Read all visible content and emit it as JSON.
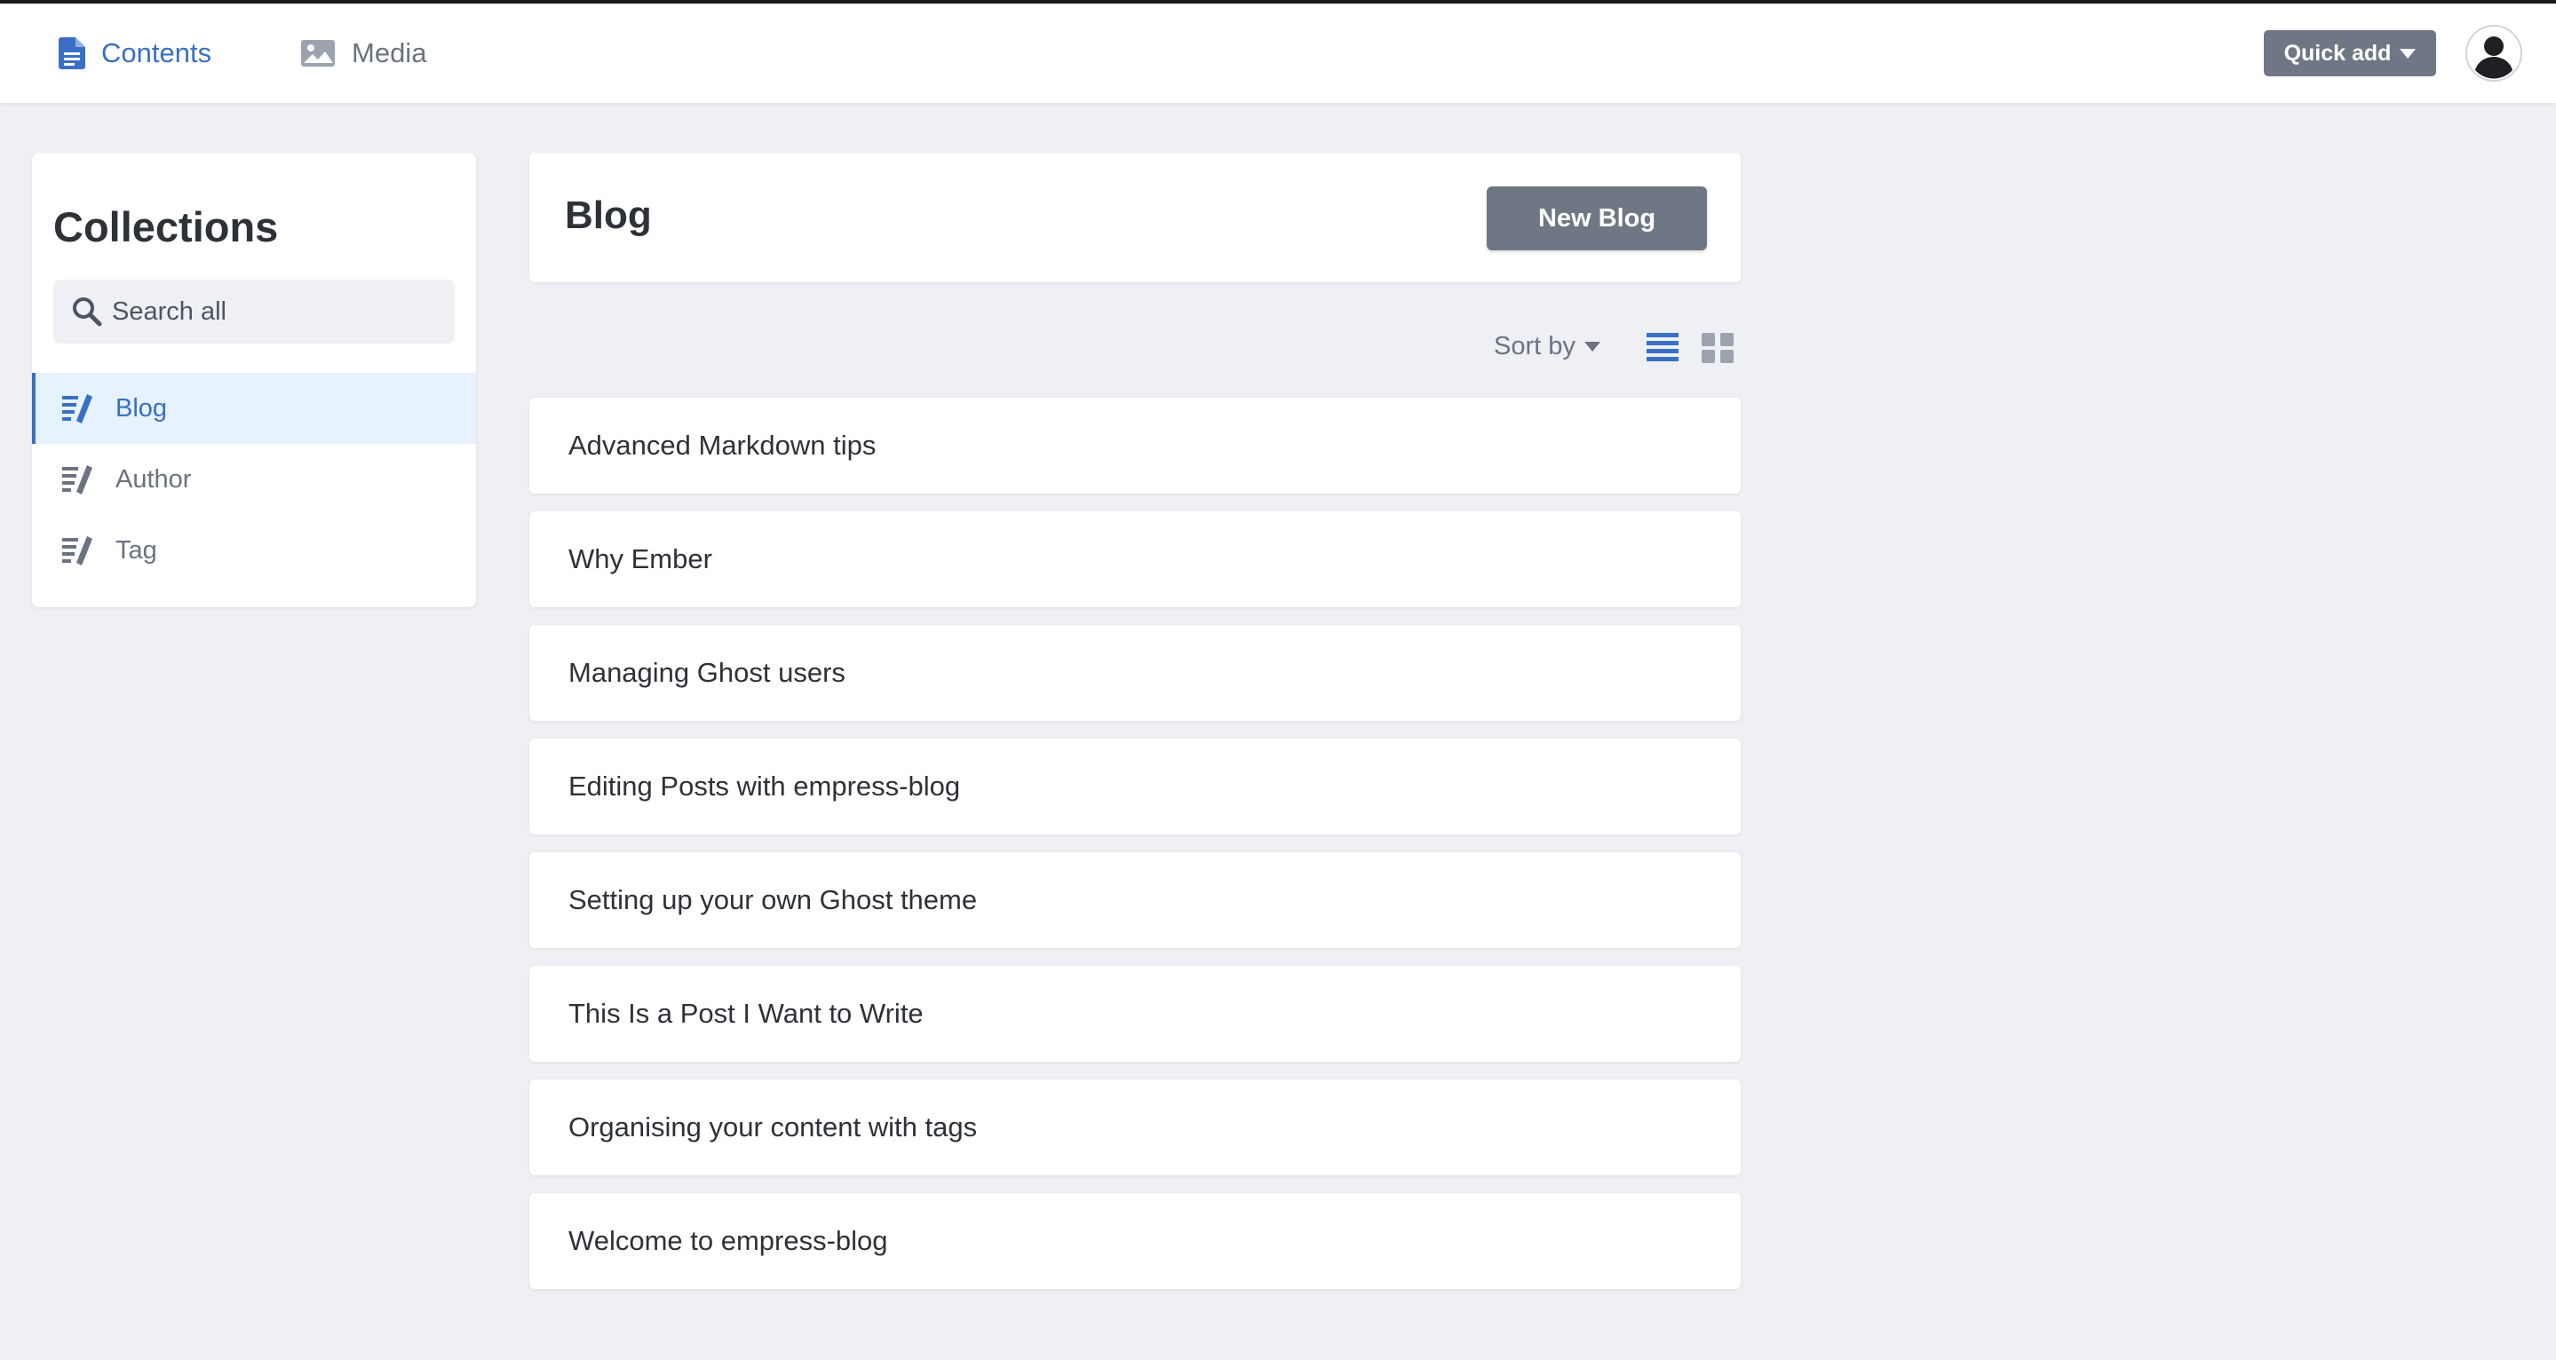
{
  "topbar": {
    "nav": [
      {
        "label": "Contents",
        "icon": "document-icon",
        "active": true
      },
      {
        "label": "Media",
        "icon": "image-icon",
        "active": false
      }
    ],
    "quick_add_label": "Quick add",
    "avatar_icon": "user-avatar-icon"
  },
  "sidebar": {
    "title": "Collections",
    "search_placeholder": "Search all",
    "items": [
      {
        "label": "Blog",
        "icon": "edit-list-icon",
        "active": true
      },
      {
        "label": "Author",
        "icon": "edit-list-icon",
        "active": false
      },
      {
        "label": "Tag",
        "icon": "edit-list-icon",
        "active": false
      }
    ]
  },
  "main": {
    "title": "Blog",
    "new_button_label": "New Blog",
    "sort_label": "Sort by",
    "view_modes": [
      {
        "name": "list",
        "icon": "list-view-icon",
        "active": true
      },
      {
        "name": "grid",
        "icon": "grid-view-icon",
        "active": false
      }
    ],
    "rows": [
      "Advanced Markdown tips",
      "Why Ember",
      "Managing Ghost users",
      "Editing Posts with empress-blog",
      "Setting up your own Ghost theme",
      "This Is a Post I Want to Write",
      "Organising your content with tags",
      "Welcome to empress-blog"
    ]
  },
  "colors": {
    "accent": "#3a6fc4",
    "button": "#6f7784",
    "background": "#eef0f4",
    "active_item_bg": "#e6f2fd"
  }
}
